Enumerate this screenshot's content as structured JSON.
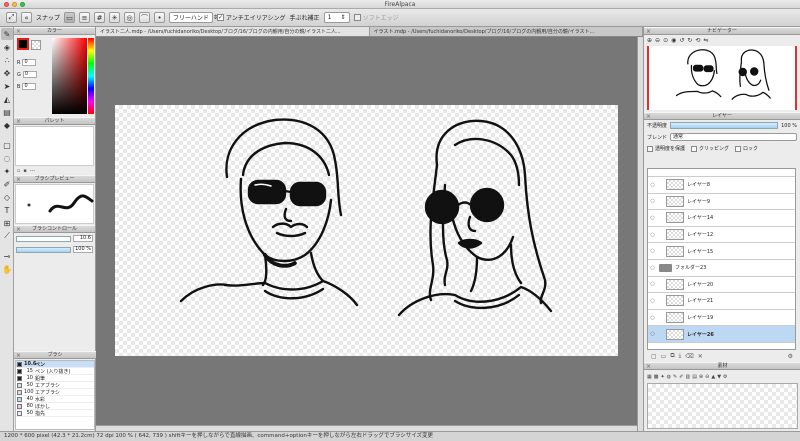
{
  "window": {
    "title": "FireAlpaca"
  },
  "toolbar": {
    "snap_label": "スナップ",
    "mode_value": "フリーハンド",
    "antialias_label": "アンチエイリアシング",
    "stabilizer_label": "手ぶれ補正",
    "stabilizer_value": "1",
    "soft_edge_label": "ソフトエッジ"
  },
  "left_panels": {
    "color": {
      "title": "カラー",
      "r_label": "R",
      "r_value": "0",
      "g_label": "G",
      "g_value": "0",
      "b_label": "B",
      "b_value": "0"
    },
    "palette": {
      "title": "パレット",
      "footer": "---"
    },
    "brush_preview": {
      "title": "ブラシプレビュー"
    },
    "brush_control": {
      "title": "ブラシコントロール",
      "size_value": "10.6",
      "opacity_value": "100 %"
    },
    "brush": {
      "title": "ブラシ",
      "items": [
        {
          "size": "10.6",
          "name": "ペン",
          "selected": true,
          "color": "#222222"
        },
        {
          "size": "15",
          "name": "ペン (入り抜き)",
          "color": "#222222"
        },
        {
          "size": "10",
          "name": "鉛筆",
          "color": "#222222"
        },
        {
          "size": "50",
          "name": "エアブラシ",
          "color": "#dddddd"
        },
        {
          "size": "100",
          "name": "エアブラシ",
          "color": "#dddddd"
        },
        {
          "size": "40",
          "name": "水彩",
          "color": "#aee3f5"
        },
        {
          "size": "80",
          "name": "ぼかし",
          "color": "#f5c6e0"
        },
        {
          "size": "50",
          "name": "指先",
          "color": "#eeeeee"
        }
      ]
    }
  },
  "documents": {
    "tabs": [
      "イラスト二人.mdp - /Users/fuchidanoriko/Desktop/ブログ/16/ブログの内観用/自分の鏡/イラスト二人...",
      "イラスト.mdp - /Users/fuchidanoriko/Desktop/ブログ/16/ブログの内観用/自分の鏡/イラスト..."
    ]
  },
  "right_panels": {
    "navigator": {
      "title": "ナビゲーター"
    },
    "layer": {
      "title": "レイヤー",
      "opacity_label": "不透明度",
      "opacity_value": "100 %",
      "blend_label": "ブレンド",
      "blend_value": "通常",
      "protect_label": "透明度を保護",
      "clipping_label": "クリッピング",
      "lock_label": "ロック",
      "items": [
        {
          "name": "",
          "type": "partial"
        },
        {
          "name": "レイヤー8",
          "type": "layer"
        },
        {
          "name": "レイヤー9",
          "type": "layer"
        },
        {
          "name": "レイヤー14",
          "type": "layer"
        },
        {
          "name": "レイヤー12",
          "type": "layer"
        },
        {
          "name": "レイヤー15",
          "type": "layer"
        },
        {
          "name": "フォルダー23",
          "type": "folder"
        },
        {
          "name": "レイヤー20",
          "type": "layer"
        },
        {
          "name": "レイヤー21",
          "type": "layer"
        },
        {
          "name": "レイヤー19",
          "type": "layer"
        },
        {
          "name": "レイヤー26",
          "type": "layer",
          "selected": true
        }
      ]
    },
    "material": {
      "title": "素材"
    }
  },
  "status": {
    "text": "1200 * 600 pixel  (42.3 * 21.2cm)  72 dpi  100 %  ( 642, 739 )  shiftキーを押しながらで直線描画、command+optionキーを押しながら左右ドラッグでブラシサイズ変更"
  }
}
